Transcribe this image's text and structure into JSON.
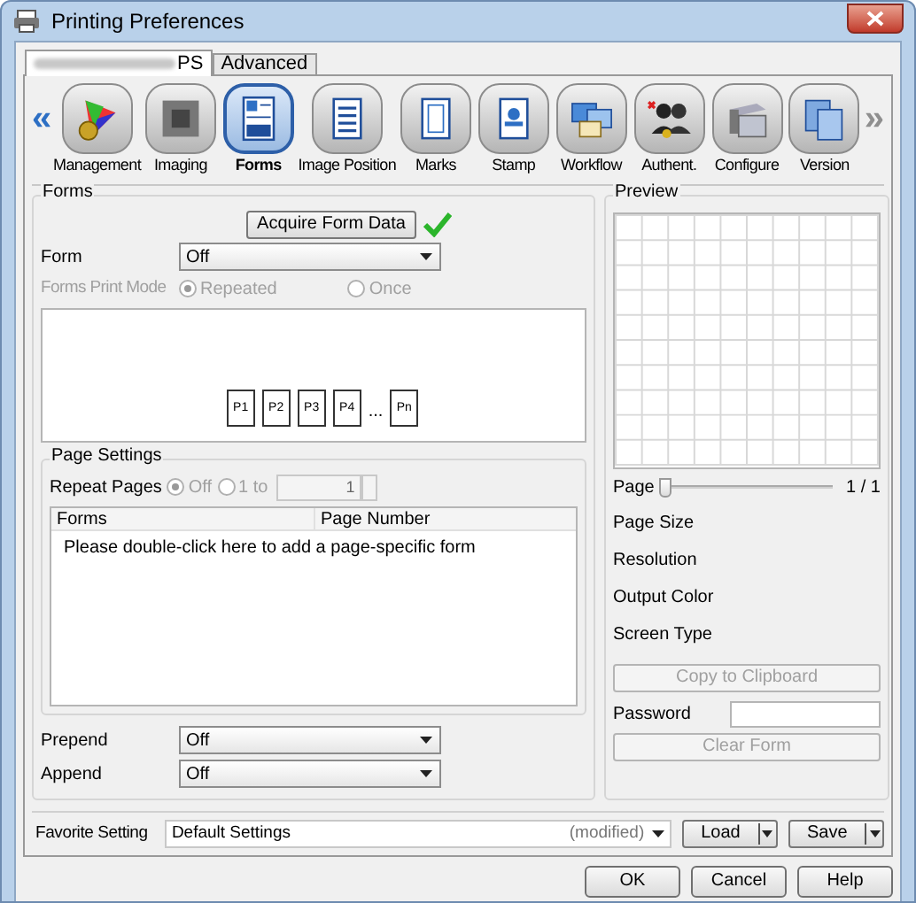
{
  "window": {
    "title": "Printing Preferences"
  },
  "tabs": [
    {
      "label": "PS",
      "selected": true
    },
    {
      "label": "Advanced",
      "selected": false
    }
  ],
  "toolbar": {
    "scroll_left": {
      "label": "«",
      "disabled": false
    },
    "scroll_right": {
      "label": "»",
      "disabled": true
    },
    "items": [
      {
        "label": "Management",
        "selected": false
      },
      {
        "label": "Imaging",
        "selected": false
      },
      {
        "label": "Forms",
        "selected": true
      },
      {
        "label": "Image Position",
        "selected": false
      },
      {
        "label": "Marks",
        "selected": false
      },
      {
        "label": "Stamp",
        "selected": false
      },
      {
        "label": "Workflow",
        "selected": false
      },
      {
        "label": "Authent.",
        "selected": false
      },
      {
        "label": "Configure",
        "selected": false
      },
      {
        "label": "Version",
        "selected": false
      }
    ]
  },
  "forms": {
    "title": "Forms",
    "acquire_button": "Acquire Form Data",
    "acquired": true,
    "form": {
      "label": "Form",
      "value": "Off"
    },
    "print_mode": {
      "label": "Forms Print Mode",
      "disabled": true,
      "options": [
        {
          "label": "Repeated",
          "selected": true
        },
        {
          "label": "Once",
          "selected": false
        }
      ]
    },
    "pages": [
      {
        "kind": "page",
        "label": "P1"
      },
      {
        "kind": "page",
        "label": "P2"
      },
      {
        "kind": "page",
        "label": "P3"
      },
      {
        "kind": "page",
        "label": "P4"
      },
      {
        "kind": "ellipsis",
        "label": "..."
      },
      {
        "kind": "page",
        "label": "Pn"
      }
    ],
    "page_settings": {
      "title": "Page Settings",
      "repeat_label": "Repeat Pages",
      "disabled": true,
      "options": [
        {
          "label": "Off",
          "selected": true
        },
        {
          "label": "1 to",
          "selected": false
        }
      ],
      "count": "1",
      "table": {
        "columns": [
          "Forms",
          "Page Number"
        ],
        "hint_row": "Please double-click here to add a page-specific form"
      }
    },
    "prepend": {
      "label": "Prepend",
      "value": "Off"
    },
    "append": {
      "label": "Append",
      "value": "Off"
    }
  },
  "preview": {
    "title": "Preview",
    "page_label": "Page",
    "level": 0,
    "page_reading": "1 / 1",
    "info": [
      "Page Size",
      "Resolution",
      "Output Color",
      "Screen Type"
    ],
    "copy_button": {
      "label": "Copy to Clipboard",
      "disabled": true
    },
    "password": {
      "label": "Password"
    },
    "clear_button": {
      "label": "Clear Form",
      "disabled": true
    }
  },
  "favorite": {
    "label": "Favorite Setting",
    "value": "Default Settings",
    "note": "(modified)",
    "buttons": [
      "Load",
      "Save"
    ]
  },
  "buttons": [
    "OK",
    "Cancel",
    "Help"
  ]
}
